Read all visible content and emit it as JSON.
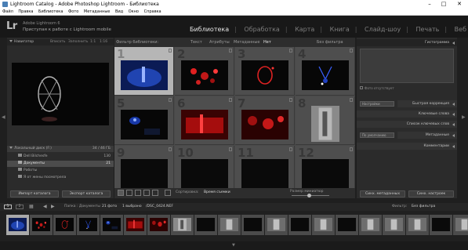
{
  "window": {
    "title": "Lightroom Catalog - Adobe Photoshop Lightroom - Библиотека"
  },
  "menu": [
    "Файл",
    "Правка",
    "Библиотека",
    "Фото",
    "Метаданные",
    "Вид",
    "Окно",
    "Справка"
  ],
  "identity": {
    "logo": "Lr",
    "line1": "Adobe Lightroom 6",
    "line2": "Приступая к работе с Lightroom mobile"
  },
  "modules": [
    {
      "label": "Библиотека",
      "active": true
    },
    {
      "label": "Обработка",
      "active": false
    },
    {
      "label": "Карта",
      "active": false
    },
    {
      "label": "Книга",
      "active": false
    },
    {
      "label": "Слайд-шоу",
      "active": false
    },
    {
      "label": "Печать",
      "active": false
    },
    {
      "label": "Веб",
      "active": false
    }
  ],
  "left": {
    "navigator_title": "Навигатор",
    "zoom": [
      "Вписать",
      "Заполнить",
      "1:1",
      "1:16"
    ],
    "catalog_row": "Локальный диск (F:)",
    "catalog_count": "34 / 46 ГБ",
    "folders": [
      {
        "label": "Dell Bilchesfe",
        "count": "130"
      },
      {
        "label": "Документы",
        "count": "21"
      },
      {
        "label": "Работы",
        "count": ""
      },
      {
        "label": "Я от жены посмотрела",
        "count": ""
      }
    ],
    "import_btn": "Импорт каталога",
    "export_btn": "Экспорт каталога"
  },
  "grid": {
    "filter_label": "Фильтр библиотеки:",
    "filter_tabs": [
      "Текст",
      "Атрибуты",
      "Метаданные",
      "Нет"
    ],
    "filter_preset": "Без фильтра",
    "cells": [
      {
        "n": "1",
        "kind": "blue",
        "selected": true
      },
      {
        "n": "2",
        "kind": "redbokeh",
        "selected": false
      },
      {
        "n": "3",
        "kind": "redring",
        "selected": false
      },
      {
        "n": "4",
        "kind": "bluestage",
        "selected": false
      },
      {
        "n": "5",
        "kind": "blue2",
        "selected": false
      },
      {
        "n": "6",
        "kind": "redstage",
        "selected": false
      },
      {
        "n": "7",
        "kind": "redcrowd",
        "selected": false
      },
      {
        "n": "8",
        "kind": "tall",
        "selected": false
      },
      {
        "n": "9",
        "kind": "dark",
        "selected": false
      },
      {
        "n": "10",
        "kind": "dark",
        "selected": false
      },
      {
        "n": "11",
        "kind": "dark",
        "selected": false
      },
      {
        "n": "12",
        "kind": "dark",
        "selected": false
      }
    ]
  },
  "toolbar": {
    "sort_label": "Сортировка:",
    "sort_value": "Время съемки",
    "thumb_label": "Размер миниатюр"
  },
  "right": {
    "histogram": "Гистограмма",
    "original_photo": "Фото отсутствует",
    "preset_select": "Настройки",
    "quick_develop": "Быстрая коррекция",
    "keywording": "Ключевые слова",
    "keyword_list": "Список ключевых слов",
    "meta_select": "По умолчанию",
    "metadata": "Метаданные",
    "comments": "Комментарии",
    "sync_btn": "Синх. метаданных",
    "sync2_btn": "Синх. настроек"
  },
  "filmstrip": {
    "pages": [
      "1",
      "2"
    ],
    "path": "Папка : Документы",
    "count": "21 фото",
    "selected": "1 выбрано",
    "file": "/DSC_0424.NEF",
    "filter_label": "Фильтр:",
    "filter_value": "Без фильтра",
    "thumbs": [
      "blue",
      "redbokeh",
      "redring",
      "bluestage",
      "blue2",
      "redstage",
      "redcrowd",
      "tall",
      "dark",
      "light",
      "dark",
      "light",
      "dark",
      "light",
      "dark",
      "light",
      "light",
      "light",
      "dark",
      "light"
    ]
  },
  "colors": {
    "accent_active": "#e6e6e6",
    "panel": "#2b2b2b",
    "grid": "#4a4a4a"
  }
}
